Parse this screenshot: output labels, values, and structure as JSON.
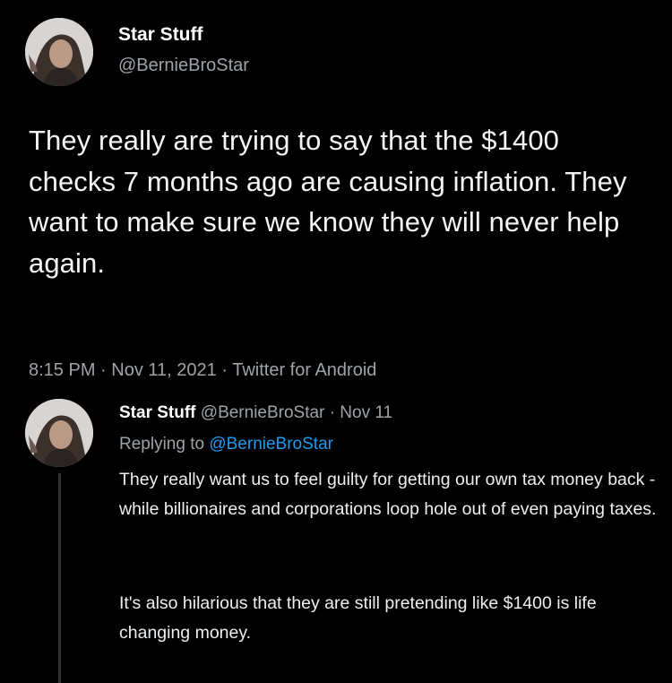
{
  "main_tweet": {
    "display_name": "Star Stuff",
    "handle": "@BernieBroStar",
    "text": "They really are trying to say that the $1400 checks 7 months ago are causing inflation. They want to make sure we know they will never help again.",
    "time": "8:15 PM",
    "separator": "·",
    "date": "Nov 11, 2021",
    "source": "Twitter for Android"
  },
  "reply": {
    "display_name": "Star Stuff",
    "handle": "@BernieBroStar",
    "separator": "·",
    "date": "Nov 11",
    "replying_prefix": "Replying to",
    "replying_to": "@BernieBroStar",
    "paragraph_1": "They really want us to feel guilty for getting our own tax money back - while billionaires and corporations loop hole out of even paying taxes.",
    "paragraph_2": "It's also hilarious that they are still pretending like $1400 is life changing money."
  },
  "colors": {
    "background": "#000000",
    "text_primary": "#e7e9ea",
    "text_secondary": "#9ea3a8",
    "mention": "#1d9bf0",
    "thread_line": "#2f3336"
  },
  "icons": {
    "main_avatar": "profile-photo-avatar",
    "reply_avatar": "profile-photo-avatar"
  }
}
